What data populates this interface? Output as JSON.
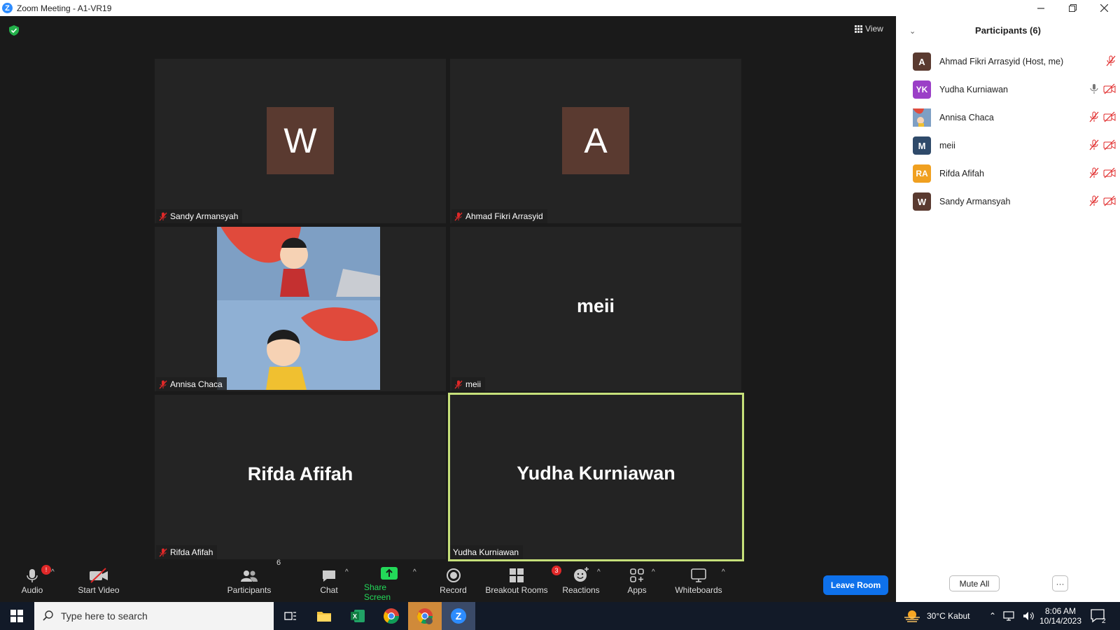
{
  "window": {
    "title": "Zoom Meeting - A1-VR19",
    "logo_letter": "Z"
  },
  "view_label": "View",
  "tiles": [
    {
      "name": "Sandy Armansyah",
      "avatar_letter": "W",
      "muted": true
    },
    {
      "name": "Ahmad Fikri Arrasyid",
      "avatar_letter": "A",
      "muted": true
    },
    {
      "name": "Annisa Chaca",
      "muted": true
    },
    {
      "name": "meii",
      "display": "meii",
      "muted": true
    },
    {
      "name": "Rifda Afifah",
      "display": "Rifda Afifah",
      "muted": true
    },
    {
      "name": "Yudha Kurniawan",
      "display": "Yudha Kurniawan",
      "muted": false,
      "active_speaker": true
    }
  ],
  "toolbar": {
    "audio": "Audio",
    "audio_badge": "!",
    "start_video": "Start Video",
    "participants": "Participants",
    "participants_count": "6",
    "chat": "Chat",
    "share_screen": "Share Screen",
    "record": "Record",
    "breakout_rooms": "Breakout Rooms",
    "breakout_badge": "3",
    "reactions": "Reactions",
    "apps": "Apps",
    "whiteboards": "Whiteboards",
    "leave": "Leave Room"
  },
  "panel": {
    "title": "Participants (6)",
    "participants": [
      {
        "initials": "A",
        "name": "Ahmad Fikri Arrasyid (Host, me)",
        "color": "#5a3a30",
        "mic": "muted",
        "video": "none"
      },
      {
        "initials": "YK",
        "name": "Yudha Kurniawan",
        "color": "#9b3fc7",
        "mic": "on",
        "video": "off"
      },
      {
        "initials": "",
        "name": "Annisa Chaca",
        "color": "#6a8fb8",
        "mic": "muted",
        "video": "off"
      },
      {
        "initials": "M",
        "name": "meii",
        "color": "#2f4a6a",
        "mic": "muted",
        "video": "off"
      },
      {
        "initials": "RA",
        "name": "Rifda Afifah",
        "color": "#f0a020",
        "mic": "muted",
        "video": "off"
      },
      {
        "initials": "W",
        "name": "Sandy Armansyah",
        "color": "#5a3a30",
        "mic": "muted",
        "video": "off"
      }
    ],
    "mute_all": "Mute All",
    "more": "···"
  },
  "taskbar": {
    "search_placeholder": "Type here to search",
    "weather": "30°C  Kabut",
    "time": "8:06 AM",
    "date": "10/14/2023",
    "notifications": "2"
  },
  "colors": {
    "accent": "#0e71eb",
    "active_border": "#c6e07a",
    "muted_red": "#e02828",
    "share_green": "#23d959"
  }
}
